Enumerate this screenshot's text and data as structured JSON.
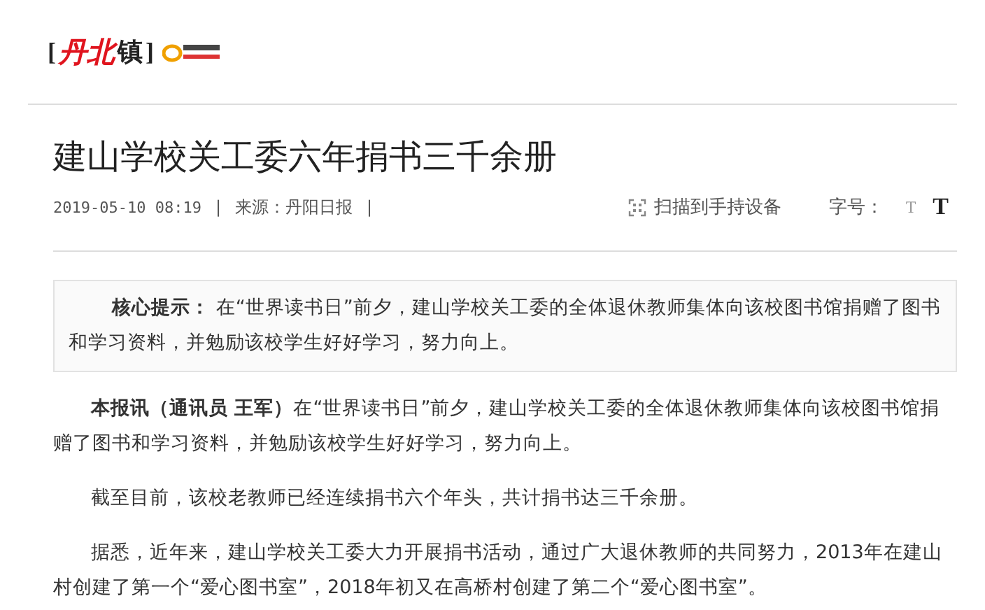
{
  "logo": {
    "open_bracket": "[",
    "name": "丹北",
    "suffix": "镇",
    "close_bracket": "]"
  },
  "article": {
    "title": "建山学校关工委六年捐书三千余册",
    "meta": {
      "datetime": "2019-05-10 08:19",
      "separator_1": "|",
      "source": "来源：丹阳日报",
      "separator_2": "|",
      "scan_label": "扫描到手持设备",
      "font_size_label": "字号：",
      "font_sizes": [
        {
          "label": "T",
          "kind": "small",
          "selected": false
        },
        {
          "label": "T",
          "kind": "large",
          "selected": true
        }
      ]
    },
    "summary": "**核心提示：** 在“世界读书日”前夕，建山学校关工委的全体退休教师集体向该校图书馆捐赠了图书和学习资料，并勉励该校学生好好学习，努力向上。",
    "paragraphs": [
      "**本报讯（通讯员 王军）**在“世界读书日”前夕，建山学校关工委的全体退休教师集体向该校图书馆捐赠了图书和学习资料，并勉励该校学生好好学习，努力向上。",
      "截至目前，该校老教师已经连续捐书六个年头，共计捐书达三千余册。",
      "据悉，近年来，建山学校关工委大力开展捐书活动，通过广大退休教师的共同努力，2013年在建山村创建了第一个“爱心图书室”，2018年初又在高桥村创建了第二个“爱心图书室”。"
    ]
  }
}
